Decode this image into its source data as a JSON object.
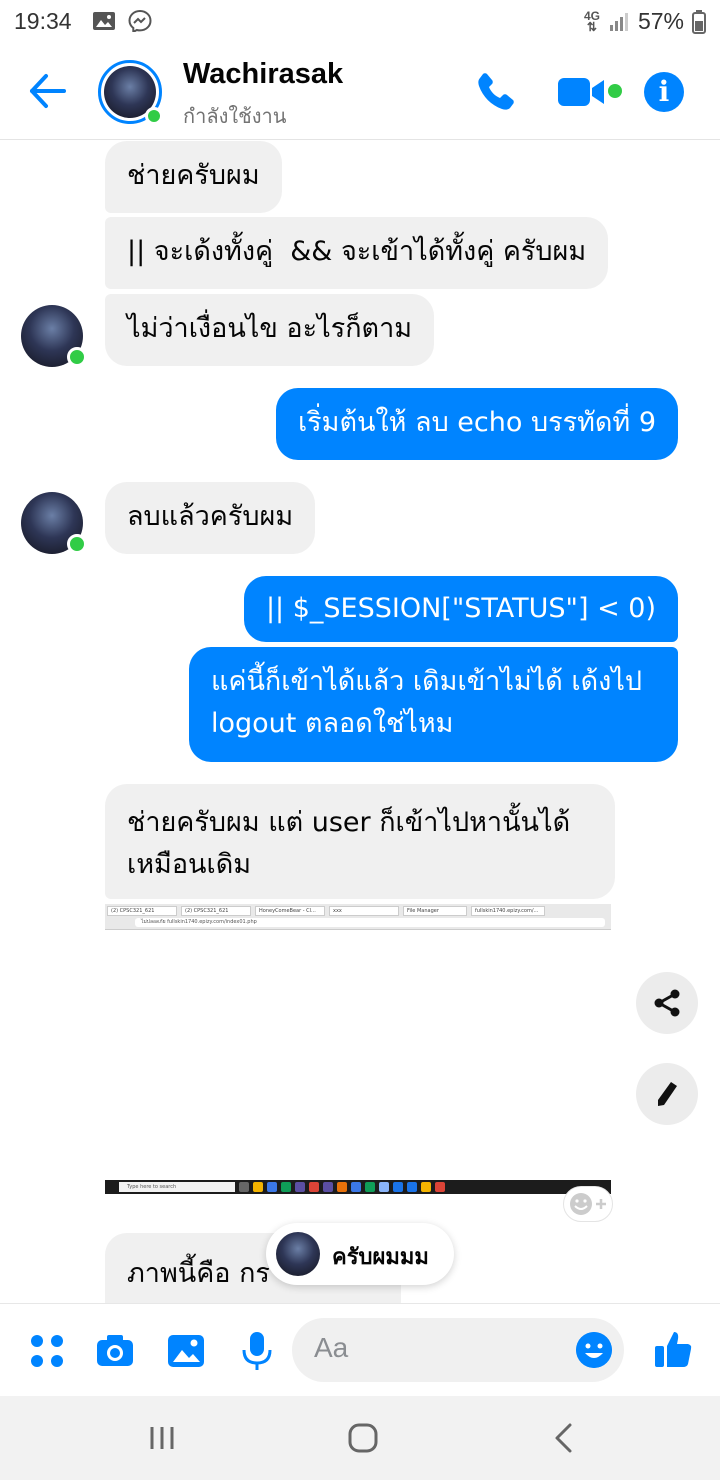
{
  "status_bar": {
    "time": "19:34",
    "network": "4G",
    "battery": "57%"
  },
  "header": {
    "contact_name": "Wachirasak",
    "contact_status": "กำลังใช้งาน"
  },
  "messages": [
    {
      "side": "in",
      "text": "ช่ายครับผม"
    },
    {
      "side": "in",
      "text": "|| จะเด้งทั้งคู่  && จะเข้าได้ทั้งคู่ ครับผม"
    },
    {
      "side": "in",
      "text": "ไม่ว่าเงื่อนไข อะไรก็ตาม"
    },
    {
      "side": "out",
      "text": "เริ่มต้นให้ ลบ echo บรรทัดที่ 9"
    },
    {
      "side": "in",
      "text": "ลบแล้วครับผม"
    },
    {
      "side": "out",
      "text": "|| $_SESSION[\"STATUS\"] < 0)"
    },
    {
      "side": "out",
      "text": "แค่นี้ก็เข้าได้แล้ว เดิมเข้าไม่ได้ เด้งไป logout ตลอดใช่ไหม"
    },
    {
      "side": "in",
      "text": "ช่ายครับผม แต่ user ก็เข้าไปหานั้นได้เหมือนเดิม"
    },
    {
      "side": "in",
      "text": "ภาพนี้คือ กร"
    }
  ],
  "screenshot_attachment": {
    "tabs": [
      "(2) CPSC321_621",
      "(2) CPSC321_621",
      "HoneyComeBear - Cl...",
      "xxx",
      "File Manager",
      "fullskin1740.epizy.com/..."
    ],
    "url": "ไม่ปลอดภัย  fullskin1740.epizy.com/index01.php",
    "taskbar_search": "Type here to search"
  },
  "typing_indicator": {
    "text": "ครับผมมม"
  },
  "composer": {
    "placeholder": "Aa"
  },
  "colors": {
    "accent": "#0084ff",
    "online": "#31cc46",
    "incoming_bubble": "#f0f0f0"
  }
}
